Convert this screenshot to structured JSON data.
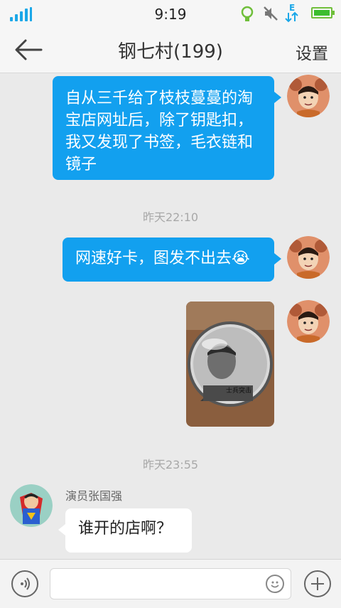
{
  "status_bar": {
    "time": "9:19"
  },
  "nav": {
    "title": "钢七村(199)",
    "settings_label": "设置"
  },
  "messages": {
    "m1_text": "自从三千给了枝枝蔓蔓的淘宝店网址后，除了钥匙扣，我又发现了书签，毛衣链和镜子",
    "ts1": "昨天22:10",
    "m2_text": "网速好卡，图发不出去😭",
    "image_caption": "士兵突击",
    "ts2": "昨天23:55",
    "sender_name": "演员张国强",
    "m4_text": "谁开的店啊？"
  },
  "input": {
    "placeholder": ""
  },
  "colors": {
    "accent": "#12a0ef",
    "background": "#eaeaea"
  }
}
